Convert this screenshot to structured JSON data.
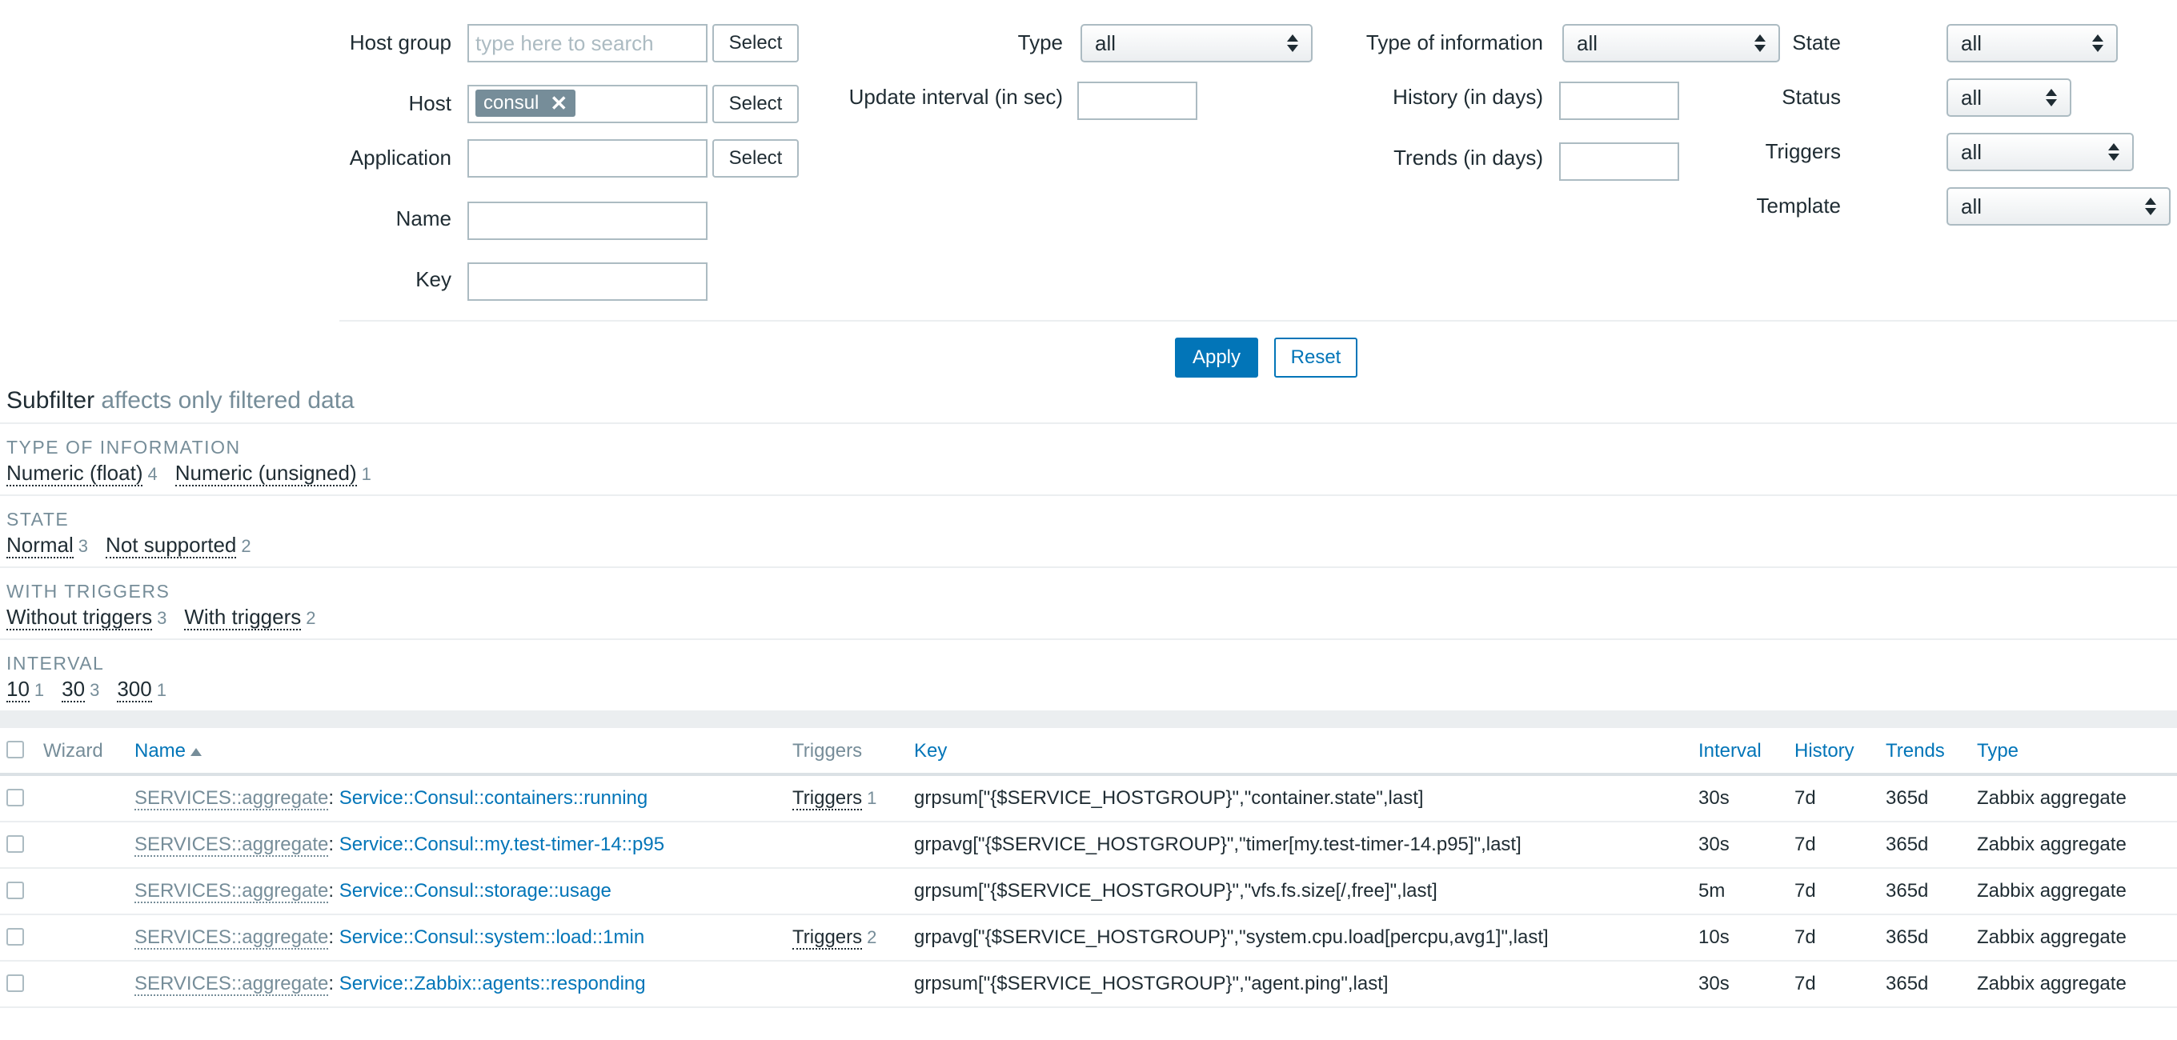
{
  "filter": {
    "host_group": {
      "label": "Host group",
      "placeholder": "type here to search",
      "button": "Select"
    },
    "host": {
      "label": "Host",
      "tag": "consul",
      "tag_remove_icon": "close-icon",
      "button": "Select"
    },
    "application": {
      "label": "Application",
      "value": "",
      "button": "Select"
    },
    "name": {
      "label": "Name",
      "value": ""
    },
    "key": {
      "label": "Key",
      "value": ""
    },
    "type": {
      "label": "Type",
      "value": "all"
    },
    "update_interval": {
      "label": "Update interval (in sec)",
      "value": ""
    },
    "type_of_information": {
      "label": "Type of information",
      "value": "all"
    },
    "history": {
      "label": "History (in days)",
      "value": ""
    },
    "trends": {
      "label": "Trends (in days)",
      "value": ""
    },
    "state": {
      "label": "State",
      "value": "all"
    },
    "status": {
      "label": "Status",
      "value": "all"
    },
    "triggers": {
      "label": "Triggers",
      "value": "all"
    },
    "template": {
      "label": "Template",
      "value": "all"
    },
    "apply": "Apply",
    "reset": "Reset"
  },
  "subfilter": {
    "title": "Subfilter",
    "note": "affects only filtered data",
    "groups": [
      {
        "heading": "TYPE OF INFORMATION",
        "items": [
          {
            "label": "Numeric (float)",
            "count": "4"
          },
          {
            "label": "Numeric (unsigned)",
            "count": "1"
          }
        ]
      },
      {
        "heading": "STATE",
        "items": [
          {
            "label": "Normal",
            "count": "3"
          },
          {
            "label": "Not supported",
            "count": "2"
          }
        ]
      },
      {
        "heading": "WITH TRIGGERS",
        "items": [
          {
            "label": "Without triggers",
            "count": "3"
          },
          {
            "label": "With triggers",
            "count": "2"
          }
        ]
      },
      {
        "heading": "INTERVAL",
        "items": [
          {
            "label": "10",
            "count": "1"
          },
          {
            "label": "30",
            "count": "3"
          },
          {
            "label": "300",
            "count": "1"
          }
        ]
      }
    ]
  },
  "table": {
    "headers": {
      "wizard": "Wizard",
      "name": "Name",
      "triggers": "Triggers",
      "key": "Key",
      "interval": "Interval",
      "history": "History",
      "trends": "Trends",
      "type": "Type"
    },
    "rows": [
      {
        "prefix": "SERVICES::aggregate",
        "name": "Service::Consul::containers::running",
        "triggers_label": "Triggers",
        "triggers_count": "1",
        "key": "grpsum[\"{$SERVICE_HOSTGROUP}\",\"container.state\",last]",
        "interval": "30s",
        "history": "7d",
        "trends": "365d",
        "type": "Zabbix aggregate"
      },
      {
        "prefix": "SERVICES::aggregate",
        "name": "Service::Consul::my.test-timer-14::p95",
        "triggers_label": "",
        "triggers_count": "",
        "key": "grpavg[\"{$SERVICE_HOSTGROUP}\",\"timer[my.test-timer-14.p95]\",last]",
        "interval": "30s",
        "history": "7d",
        "trends": "365d",
        "type": "Zabbix aggregate"
      },
      {
        "prefix": "SERVICES::aggregate",
        "name": "Service::Consul::storage::usage",
        "triggers_label": "",
        "triggers_count": "",
        "key": "grpsum[\"{$SERVICE_HOSTGROUP}\",\"vfs.fs.size[/,free]\",last]",
        "interval": "5m",
        "history": "7d",
        "trends": "365d",
        "type": "Zabbix aggregate"
      },
      {
        "prefix": "SERVICES::aggregate",
        "name": "Service::Consul::system::load::1min",
        "triggers_label": "Triggers",
        "triggers_count": "2",
        "key": "grpavg[\"{$SERVICE_HOSTGROUP}\",\"system.cpu.load[percpu,avg1]\",last]",
        "interval": "10s",
        "history": "7d",
        "trends": "365d",
        "type": "Zabbix aggregate"
      },
      {
        "prefix": "SERVICES::aggregate",
        "name": "Service::Zabbix::agents::responding",
        "triggers_label": "",
        "triggers_count": "",
        "key": "grpsum[\"{$SERVICE_HOSTGROUP}\",\"agent.ping\",last]",
        "interval": "30s",
        "history": "7d",
        "trends": "365d",
        "type": "Zabbix aggregate"
      }
    ]
  },
  "colors": {
    "accent": "#0275b8",
    "muted": "#768d99",
    "border": "#acbbc2",
    "tag": "#768d99"
  }
}
